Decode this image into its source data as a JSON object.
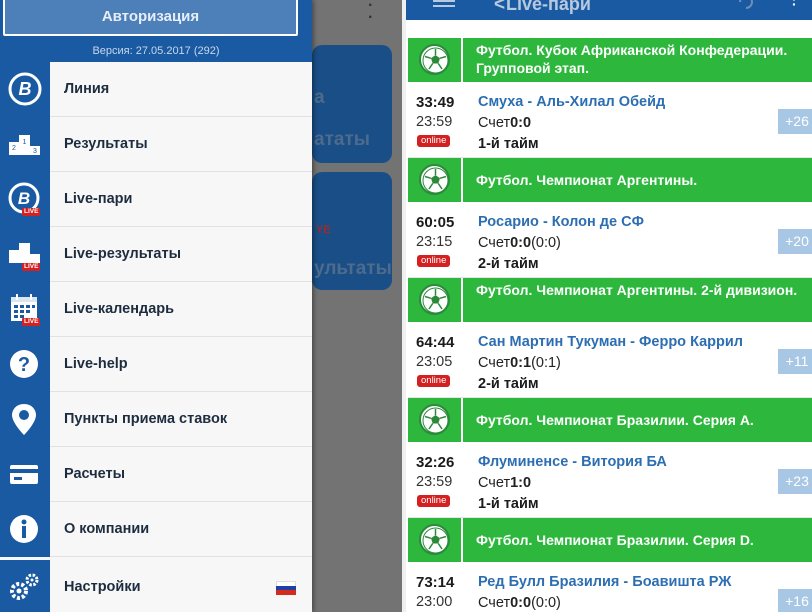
{
  "drawer": {
    "auth_button": "Авторизация",
    "version": "Версия: 27.05.2017 (292)",
    "live_tag": "LIVE",
    "items": [
      {
        "label": "Линия",
        "icon": "bet-logo-icon"
      },
      {
        "label": "Результаты",
        "icon": "podium-icon"
      },
      {
        "label": "Live-пари",
        "icon": "bet-logo-live-icon"
      },
      {
        "label": "Live-результаты",
        "icon": "podium-live-icon"
      },
      {
        "label": "Live-календарь",
        "icon": "calendar-live-icon"
      },
      {
        "label": "Live-help",
        "icon": "question-icon"
      },
      {
        "label": "Пункты приема ставок",
        "icon": "location-pin-icon"
      },
      {
        "label": "Расчеты",
        "icon": "credit-card-icon"
      },
      {
        "label": "О компании",
        "icon": "info-icon"
      },
      {
        "label": "Настройки",
        "icon": "gears-icon"
      }
    ],
    "settings_flag": "russian-flag-icon"
  },
  "background_screen": {
    "tiles": [
      "атыатыатыатыатыатыатыа",
      "ультаты"
    ],
    "tile_top_text": "а",
    "tile_live_fragment": "YE"
  },
  "appbar": {
    "title": "Live-пари",
    "back_glyph": "<"
  },
  "events": [
    {
      "league": "Футбол. Кубок Африканской Конфедерации. Групповой этап.",
      "elapsed": "33:49",
      "start": "23:59",
      "status": "online",
      "teams": "Смуха - Аль-Хилал Обейд",
      "score_label": "Счет",
      "score": "0:0",
      "score_extra": "",
      "period": "1-й тайм",
      "more": "+26"
    },
    {
      "league": "Футбол. Чемпионат Аргентины.",
      "elapsed": "60:05",
      "start": "23:15",
      "status": "online",
      "teams": "Росарио - Колон де СФ",
      "score_label": "Счет",
      "score": "0:0",
      "score_extra": "(0:0)",
      "period": "2-й тайм",
      "more": "+20"
    },
    {
      "league": "Футбол. Чемпионат Аргентины. 2-й дивизион.",
      "elapsed": "64:44",
      "start": "23:05",
      "status": "online",
      "teams": "Сан Мартин Тукуман - Ферро Каррил",
      "score_label": "Счет",
      "score": "0:1",
      "score_extra": "(0:1)",
      "period": "2-й тайм",
      "more": "+11"
    },
    {
      "league": "Футбол. Чемпионат Бразилии. Серия А.",
      "elapsed": "32:26",
      "start": "23:59",
      "status": "online",
      "teams": "Флуминенсе - Витория БА",
      "score_label": "Счет",
      "score": "1:0",
      "score_extra": "",
      "period": "1-й тайм",
      "more": "+23"
    },
    {
      "league": "Футбол. Чемпионат Бразилии. Серия D.",
      "elapsed": "73:14",
      "start": "23:00",
      "status": "",
      "teams": "Ред Булл Бразилия - Боавишта РЖ",
      "score_label": "Счет",
      "score": "0:0",
      "score_extra": "(0:0)",
      "period": "",
      "more": "+16"
    }
  ],
  "colors": {
    "brand_blue": "#1a5aa2",
    "league_green": "#2db83d",
    "team_blue": "#2c6eb1",
    "live_red": "#d42020",
    "more_button": "#a8c7e5"
  }
}
